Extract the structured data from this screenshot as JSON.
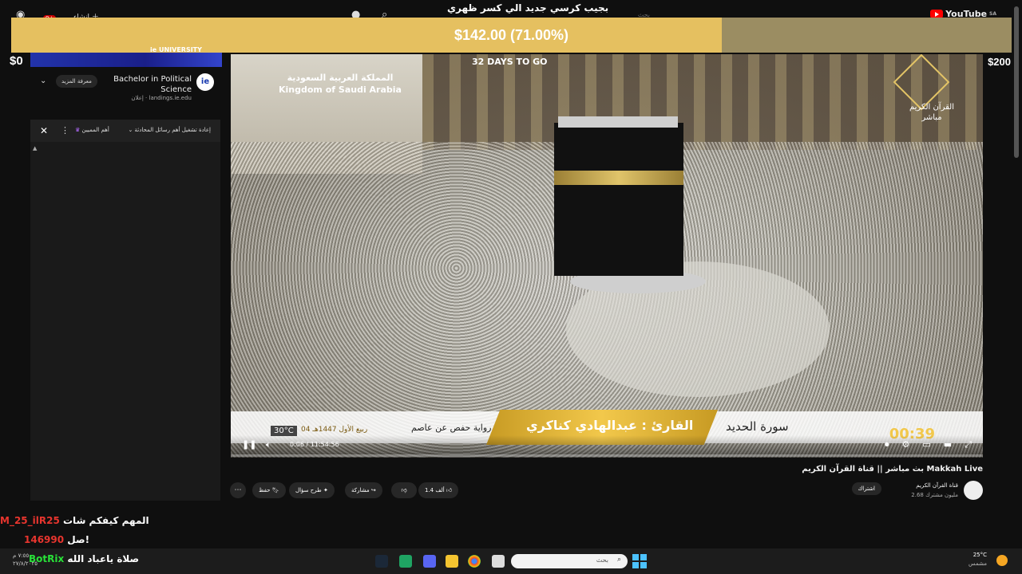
{
  "header": {
    "logo": "YouTube",
    "region": "SA",
    "search_placeholder": "بحث",
    "create_label": "إنشاء",
    "notification_count": "9+"
  },
  "goal": {
    "message": "بجيب كرسي جديد الي كسر ظهري",
    "amount_text": "$142.00 (71.00%)",
    "progress": 0.71,
    "min_label": "$0",
    "max_label": "$200"
  },
  "ad": {
    "banner_logo": "ie UNIVERSITY",
    "avatar": "ie",
    "title": "Bachelor in Political Science",
    "sponsored": "إعلان",
    "domain": "landings.ie.edu",
    "more_label": "معرفة المزيد"
  },
  "chat": {
    "title": "إعادة تشغيل أهم رسائل المحادثة",
    "members_label": "أهم المميين"
  },
  "video_overlay": {
    "country_ar": "المملكة العربية السعودية",
    "country_en": "Kingdom of Saudi Arabia",
    "countdown": "32 DAYS TO GO",
    "channel_logo_text": "القرآن الكريم",
    "live_label": "مباشر",
    "reader": "القارئ : عبدالهادي كناكري",
    "surah": "سورة الحديد",
    "riwaya": "رواية حفص عن عاصم",
    "hijri_date": "04 ربيع الأول 1447هـ",
    "temperature": "30°C",
    "timer": "00:39"
  },
  "player": {
    "time": "0:06 / 11:54:56"
  },
  "video_info": {
    "title": "بث مباشر || قناة القرآن الكريم Makkah Live",
    "channel": "قناة القرآن الكريم",
    "subscribers": "2.68 مليون مشترك",
    "subscribe": "اشتراك",
    "likes": "1.4 ألف",
    "share": "مشاركة",
    "ask": "طرح سؤال",
    "save": "حفظ"
  },
  "chat_messages": [
    {
      "user": "M_25_ilR25",
      "text": "المهم كيفكم شات"
    },
    {
      "user": "146990",
      "text": "صل!"
    },
    {
      "user": "BotRix",
      "text": "صلاة ياعباد الله"
    }
  ],
  "taskbar": {
    "search_placeholder": "بحث",
    "weather_temp": "25°C",
    "weather_desc": "مشمس",
    "clock_time": "٧:٥٥ م",
    "clock_date": "٢٧/٨/٢٠٢٥"
  }
}
